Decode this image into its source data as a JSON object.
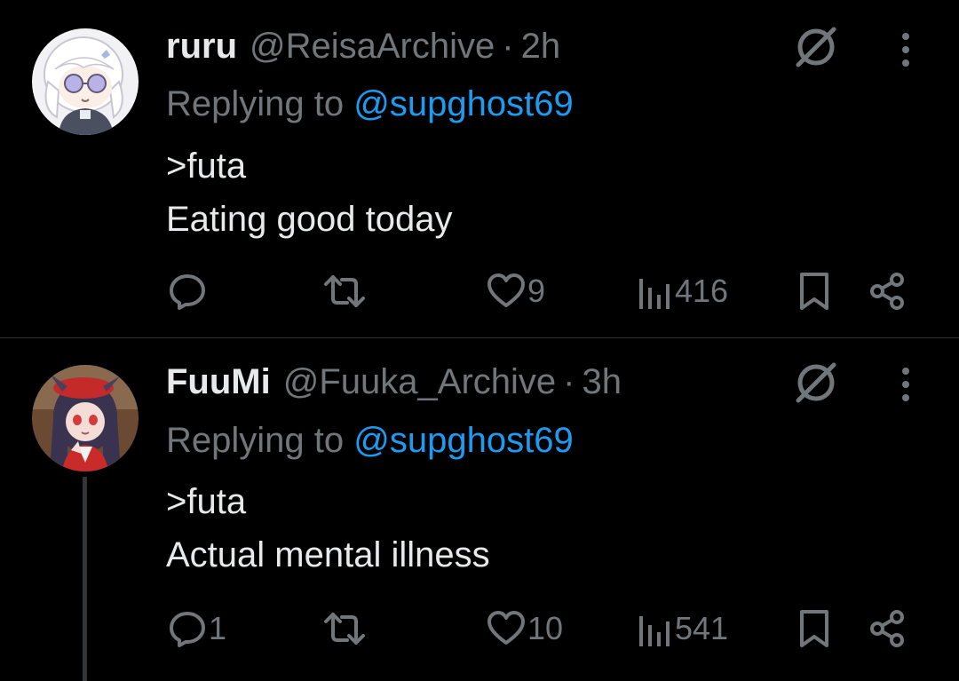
{
  "tweets": [
    {
      "display_name": "ruru",
      "handle": "@ReisaArchive",
      "separator": "·",
      "time": "2h",
      "reply_prefix": "Replying to",
      "reply_to": "@supghost69",
      "lines": [
        ">futa",
        "Eating good today"
      ],
      "replies": "",
      "likes": "9",
      "views": "416"
    },
    {
      "display_name": "FuuMi",
      "handle": "@Fuuka_Archive",
      "separator": "·",
      "time": "3h",
      "reply_prefix": "Replying to",
      "reply_to": "@supghost69",
      "lines": [
        ">futa",
        "Actual mental illness"
      ],
      "replies": "1",
      "likes": "10",
      "views": "541"
    }
  ],
  "colors": {
    "background": "#000000",
    "text_primary": "#e7e9ea",
    "text_secondary": "#71767b",
    "link": "#1d9bf0",
    "divider": "#2f3336"
  },
  "icons": {
    "reply": "reply-icon",
    "repost": "repost-icon",
    "like": "heart-icon",
    "views": "views-icon",
    "bookmark": "bookmark-icon",
    "share": "share-icon",
    "grok": "grok-icon",
    "more": "more-icon"
  }
}
